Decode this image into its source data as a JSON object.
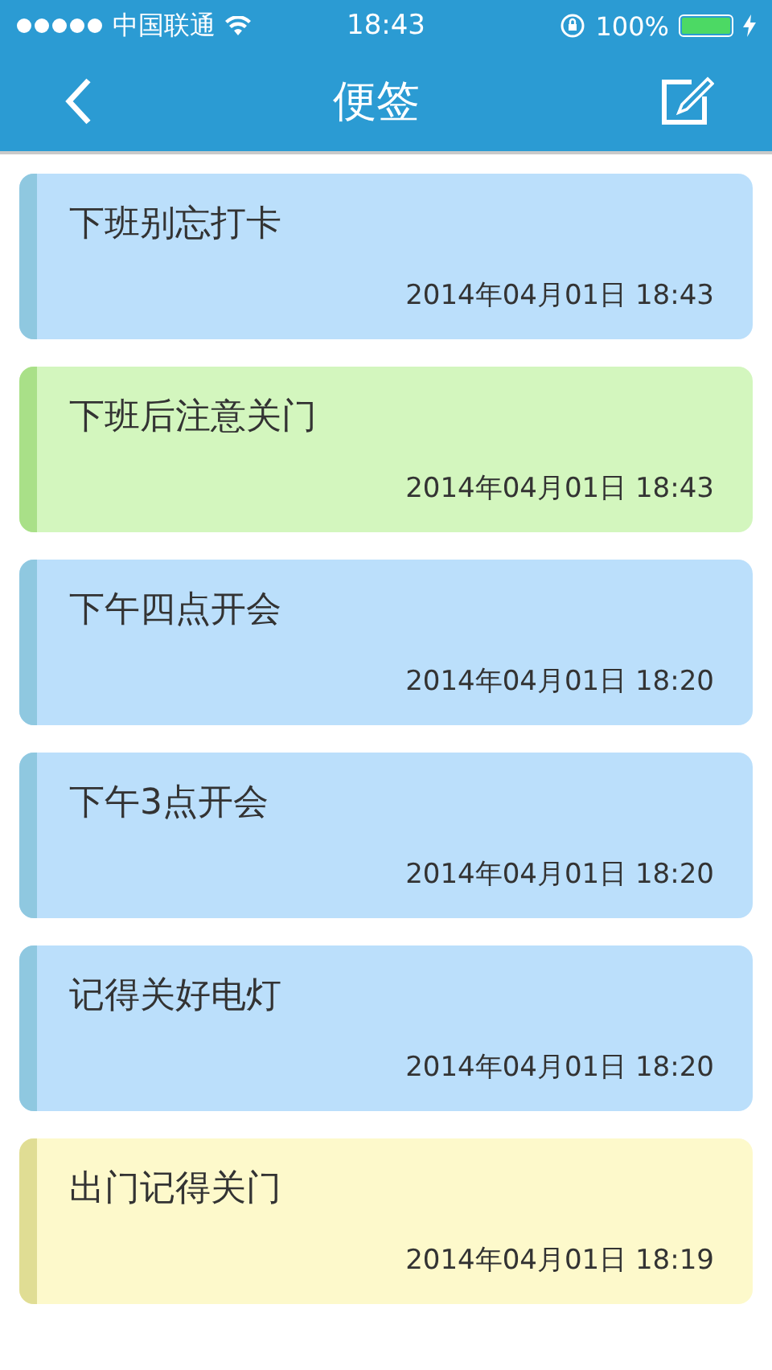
{
  "status_bar": {
    "carrier": "中国联通",
    "time": "18:43",
    "battery": "100%"
  },
  "nav": {
    "title": "便签"
  },
  "notes": [
    {
      "title": "下班别忘打卡",
      "date": "2014年04月01日 18:43",
      "color": "#bbdffb"
    },
    {
      "title": "下班后注意关门",
      "date": "2014年04月01日 18:43",
      "color": "#d3f6be"
    },
    {
      "title": "下午四点开会",
      "date": "2014年04月01日 18:20",
      "color": "#bbdffb"
    },
    {
      "title": "下午3点开会",
      "date": "2014年04月01日 18:20",
      "color": "#bbdffb"
    },
    {
      "title": "记得关好电灯",
      "date": "2014年04月01日 18:20",
      "color": "#bbdffb"
    },
    {
      "title": "出门记得关门",
      "date": "2014年04月01日 18:19",
      "color": "#fdf9cb"
    }
  ]
}
